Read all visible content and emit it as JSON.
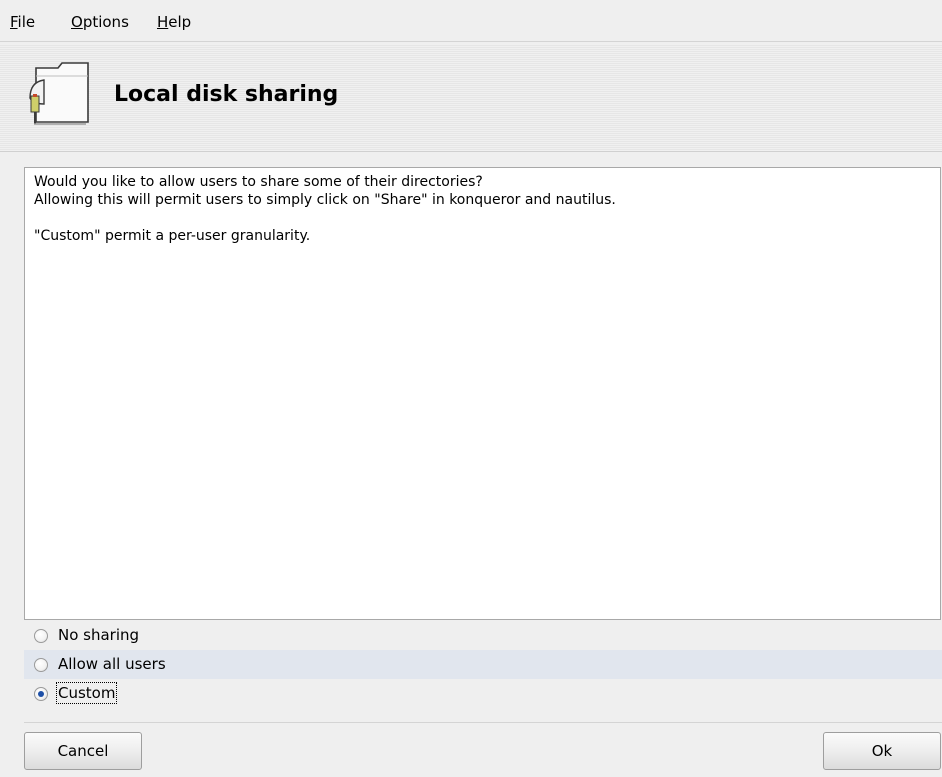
{
  "menubar": {
    "items": [
      {
        "mnemonic": "F",
        "rest": "ile"
      },
      {
        "mnemonic": "O",
        "rest": "ptions"
      },
      {
        "mnemonic": "H",
        "rest": "elp"
      }
    ]
  },
  "header": {
    "title": "Local disk sharing",
    "icon": "folder-share-icon"
  },
  "message": {
    "text": "Would you like to allow users to share some of their directories?\nAllowing this will permit users to simply click on \"Share\" in konqueror and nautilus.\n\n\"Custom\" permit a per-user granularity."
  },
  "options": [
    {
      "label": "No sharing",
      "checked": false
    },
    {
      "label": "Allow all users",
      "checked": false
    },
    {
      "label": "Custom",
      "checked": true
    }
  ],
  "buttons": {
    "cancel": "Cancel",
    "ok": "Ok"
  },
  "colors": {
    "window_bg": "#efefef",
    "selected_row": "#e1e6ee",
    "radio_dot": "#1d4fa7"
  }
}
